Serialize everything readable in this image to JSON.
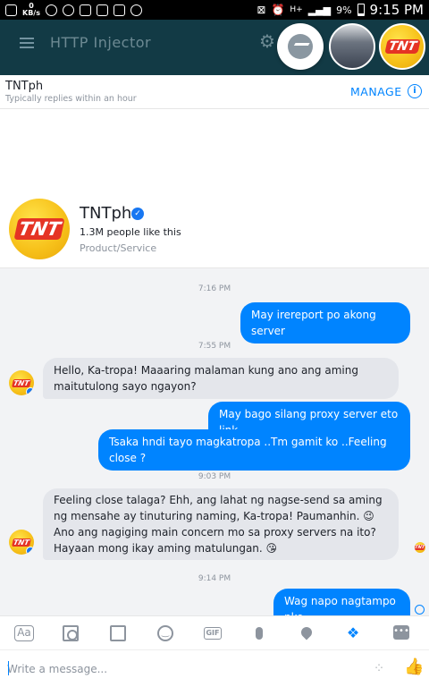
{
  "status_bar": {
    "net_speed": "0",
    "net_unit": "KB/s",
    "network": "H+",
    "battery": "9%",
    "time": "9:15 PM"
  },
  "app_bar": {
    "title": "HTTP Injector"
  },
  "chat_heads": {
    "messenger_icon": "messenger-icon",
    "group_avatar": "group-photo",
    "tnt_avatar": "TNT"
  },
  "chat_header": {
    "name": "TNTph",
    "subtitle": "Typically replies within an hour",
    "manage_label": "MANAGE",
    "info_icon": "i"
  },
  "page_card": {
    "logo_text": "TNT",
    "name": "TNTph",
    "verified_icon": "✓",
    "likes": "1.3M people like this",
    "category": "Product/Service"
  },
  "messages": {
    "ts1": "7:16 PM",
    "m1": "May irereport po akong server",
    "ts2": "7:55 PM",
    "m2": "Hello, Ka-tropa! Maaaring malaman kung ano ang aming maitutulong sayo ngayon?",
    "m3": "May bago silang proxy server eto link",
    "m4": "Tsaka hndi tayo magkatropa ..Tm gamit ko ..Feeling close ?",
    "ts3": "9:03 PM",
    "m5": "Feeling close talaga? Ehh, ang lahat ng nagse-send sa aming ng mensahe ay tinuturing naming, Ka-tropa! Paumanhin. 😉 Ano ang nagiging main concern mo sa proxy servers na ito? Hayaan mong ikay aming matulungan. 😘",
    "ts4": "9:14 PM",
    "m6": "Wag napo nagtampo nko"
  },
  "toolbar": {
    "aa": "Aa",
    "gif": "GIF",
    "more": "•••",
    "smile": "‿",
    "dropbox": "❖"
  },
  "compose": {
    "placeholder": "Write a message...",
    "cluster_icon": "⁘",
    "like_icon": "👍"
  },
  "colors": {
    "accent": "#0084ff",
    "app_bar": "#123a45",
    "incoming_bubble": "#e4e6eb",
    "tnt_yellow": "#f7c21b",
    "tnt_red": "#e53424"
  }
}
